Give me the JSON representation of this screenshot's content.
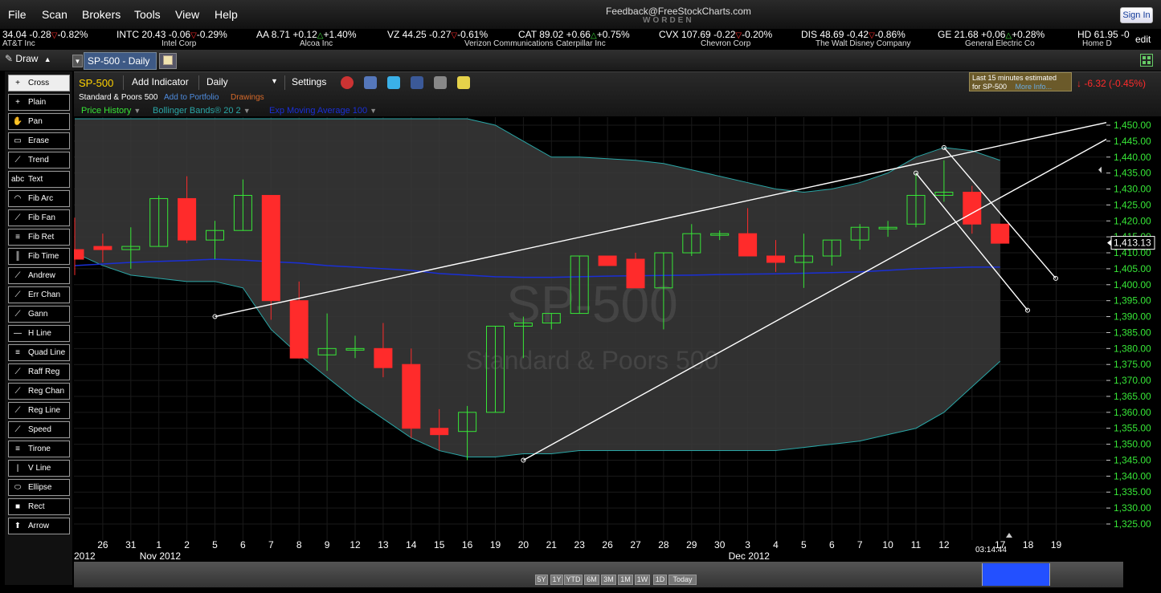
{
  "menu": {
    "items": [
      "File",
      "Scan",
      "Brokers",
      "Tools",
      "View",
      "Help"
    ],
    "feedback": "Feedback@FreeStockCharts.com",
    "brand": "WORDEN",
    "signin": "Sign In"
  },
  "ticker": [
    {
      "price": "34.04",
      "chg": "-0.28",
      "pct": "-0.82%",
      "dir": "down",
      "name": "AT&T Inc"
    },
    {
      "sym": "INTC",
      "price": "20.43",
      "chg": "-0.06",
      "pct": "-0.29%",
      "dir": "down",
      "name": "Intel Corp"
    },
    {
      "sym": "AA",
      "price": "8.71",
      "chg": "+0.12",
      "pct": "+1.40%",
      "dir": "up",
      "name": "Alcoa Inc"
    },
    {
      "sym": "VZ",
      "price": "44.25",
      "chg": "-0.27",
      "pct": "-0.61%",
      "dir": "down",
      "name": "Verizon Communications"
    },
    {
      "sym": "CAT",
      "price": "89.02",
      "chg": "+0.66",
      "pct": "+0.75%",
      "dir": "up",
      "name": "Caterpillar Inc"
    },
    {
      "sym": "CVX",
      "price": "107.69",
      "chg": "-0.22",
      "pct": "-0.20%",
      "dir": "down",
      "name": "Chevron Corp"
    },
    {
      "sym": "DIS",
      "price": "48.69",
      "chg": "-0.42",
      "pct": "-0.86%",
      "dir": "down",
      "name": "The Walt Disney Company"
    },
    {
      "sym": "GE",
      "price": "21.68",
      "chg": "+0.06",
      "pct": "+0.28%",
      "dir": "up",
      "name": "General Electric Co"
    },
    {
      "sym": "HD",
      "price": "61.95",
      "chg": "-0",
      "pct": "",
      "dir": "",
      "name": "Home D"
    }
  ],
  "toolbar": {
    "draw_label": "Draw",
    "tab_label": "SP-500 - Daily",
    "edit_label": "edit"
  },
  "tools": [
    "Cross",
    "Plain",
    "Pan",
    "Erase",
    "Trend",
    "Text",
    "Fib Arc",
    "Fib Fan",
    "Fib Ret",
    "Fib Time",
    "Andrew",
    "Err Chan",
    "Gann",
    "H Line",
    "Quad Line",
    "Raff Reg",
    "Reg Chan",
    "Reg Line",
    "Speed",
    "Tirone",
    "V Line",
    "Ellipse",
    "Rect",
    "Arrow"
  ],
  "tool_icons": [
    "+",
    "+",
    "✋",
    "▭",
    "⟋",
    "abc",
    "◠",
    "⟋",
    "≡",
    "║",
    "⟋",
    "⟋",
    "⟋",
    "—",
    "≡",
    "⟋",
    "⟋",
    "⟋",
    "⟋",
    "≡",
    "|",
    "⬭",
    "■",
    "⬆"
  ],
  "header": {
    "symbol": "SP-500",
    "add_indicator": "Add Indicator",
    "period": "Daily",
    "settings": "Settings",
    "company": "Standard & Poors 500",
    "add_portfolio": "Add to Portfolio",
    "drawings": "Drawings",
    "ind1": "Price History",
    "ind2": "Bollinger Bands® 20 2",
    "ind3": "Exp Moving Average 100",
    "est_line1": "Last 15 minutes estimated",
    "est_line2": "for SP-500",
    "more_info": "More Info...",
    "change": "-6.32 (-0.45%)"
  },
  "colors": {
    "up": "#37e637",
    "down": "#ff2b2b",
    "band_fill": "#3a3a3a",
    "band_line": "#2aa6a6",
    "ema": "#1a2fd6",
    "symbol": "#ffd200"
  },
  "chart_data": {
    "type": "candlestick",
    "watermark_symbol": "SP-500",
    "watermark_name": "Standard & Poors 500",
    "last_price": "1,413.13",
    "y_ticks": [
      "1,450.00",
      "1,445.00",
      "1,440.00",
      "1,435.00",
      "1,430.00",
      "1,425.00",
      "1,420.00",
      "1,415.00",
      "1,410.00",
      "1,405.00",
      "1,400.00",
      "1,395.00",
      "1,390.00",
      "1,385.00",
      "1,380.00",
      "1,375.00",
      "1,370.00",
      "1,365.00",
      "1,360.00",
      "1,355.00",
      "1,350.00",
      "1,345.00",
      "1,340.00",
      "1,335.00",
      "1,330.00",
      "1,325.00"
    ],
    "y_range": [
      1322,
      1452
    ],
    "x_dates": [
      "26",
      "31",
      "1",
      "2",
      "5",
      "6",
      "7",
      "8",
      "9",
      "12",
      "13",
      "14",
      "15",
      "16",
      "19",
      "20",
      "21",
      "23",
      "26",
      "27",
      "28",
      "29",
      "30",
      "3",
      "4",
      "5",
      "6",
      "7",
      "10",
      "11",
      "12",
      "",
      "17",
      "18",
      "19"
    ],
    "month_labels": [
      {
        "label": "2012",
        "index": -0.5
      },
      {
        "label": "Nov 2012",
        "index": 2
      },
      {
        "label": "Dec 2012",
        "index": 23
      },
      {
        "label": "03:14:44",
        "index": 31
      }
    ],
    "candles": [
      {
        "o": 1411,
        "h": 1421,
        "l": 1403,
        "c": 1408
      },
      {
        "o": 1412,
        "h": 1416,
        "l": 1407,
        "c": 1411
      },
      {
        "o": 1411,
        "h": 1418,
        "l": 1405,
        "c": 1412
      },
      {
        "o": 1412,
        "h": 1428,
        "l": 1412,
        "c": 1427
      },
      {
        "o": 1427,
        "h": 1434,
        "l": 1413,
        "c": 1414
      },
      {
        "o": 1414,
        "h": 1420,
        "l": 1408,
        "c": 1417
      },
      {
        "o": 1417,
        "h": 1433,
        "l": 1417,
        "c": 1428
      },
      {
        "o": 1428,
        "h": 1428,
        "l": 1389,
        "c": 1395
      },
      {
        "o": 1395,
        "h": 1401,
        "l": 1377,
        "c": 1377
      },
      {
        "o": 1378,
        "h": 1391,
        "l": 1373,
        "c": 1380
      },
      {
        "o": 1380,
        "h": 1384,
        "l": 1377,
        "c": 1380
      },
      {
        "o": 1380,
        "h": 1388,
        "l": 1371,
        "c": 1374
      },
      {
        "o": 1375,
        "h": 1380,
        "l": 1352,
        "c": 1355
      },
      {
        "o": 1355,
        "h": 1361,
        "l": 1348,
        "c": 1353
      },
      {
        "o": 1354,
        "h": 1362,
        "l": 1345,
        "c": 1360
      },
      {
        "o": 1360,
        "h": 1387,
        "l": 1360,
        "c": 1387
      },
      {
        "o": 1387,
        "h": 1390,
        "l": 1377,
        "c": 1388
      },
      {
        "o": 1388,
        "h": 1391,
        "l": 1386,
        "c": 1391
      },
      {
        "o": 1391,
        "h": 1409,
        "l": 1391,
        "c": 1409
      },
      {
        "o": 1409,
        "h": 1409,
        "l": 1406,
        "c": 1406
      },
      {
        "o": 1408,
        "h": 1410,
        "l": 1399,
        "c": 1399
      },
      {
        "o": 1399,
        "h": 1410,
        "l": 1386,
        "c": 1410
      },
      {
        "o": 1410,
        "h": 1419,
        "l": 1409,
        "c": 1416
      },
      {
        "o": 1416,
        "h": 1417,
        "l": 1414,
        "c": 1416
      },
      {
        "o": 1416,
        "h": 1424,
        "l": 1409,
        "c": 1409
      },
      {
        "o": 1409,
        "h": 1414,
        "l": 1404,
        "c": 1407
      },
      {
        "o": 1407,
        "h": 1416,
        "l": 1399,
        "c": 1409
      },
      {
        "o": 1409,
        "h": 1414,
        "l": 1406,
        "c": 1414
      },
      {
        "o": 1414,
        "h": 1419,
        "l": 1411,
        "c": 1418
      },
      {
        "o": 1418,
        "h": 1420,
        "l": 1415,
        "c": 1418
      },
      {
        "o": 1419,
        "h": 1435,
        "l": 1418,
        "c": 1428
      },
      {
        "o": 1428,
        "h": 1439,
        "l": 1426,
        "c": 1429
      },
      {
        "o": 1429,
        "h": 1431,
        "l": 1416,
        "c": 1419
      },
      {
        "o": 1419,
        "h": 1419,
        "l": 1413,
        "c": 1413
      }
    ],
    "bollinger_upper": [
      1452,
      1452,
      1452,
      1452,
      1452,
      1452,
      1452,
      1452,
      1452,
      1452,
      1452,
      1452,
      1452,
      1452,
      1452,
      1450,
      1445,
      1440,
      1440,
      1439.5,
      1439,
      1438,
      1436,
      1434,
      1432,
      1430,
      1429,
      1430,
      1432,
      1435,
      1440,
      1443,
      1442,
      1439
    ],
    "bollinger_lower": [
      1410,
      1406,
      1403,
      1402,
      1401,
      1401,
      1399,
      1386,
      1378,
      1371,
      1364,
      1358,
      1352,
      1348,
      1346,
      1346,
      1347,
      1347,
      1348,
      1348,
      1348,
      1348,
      1348,
      1348,
      1348,
      1348,
      1349,
      1350,
      1351,
      1353,
      1355,
      1360,
      1368,
      1376
    ],
    "ema100": [
      1406,
      1406.5,
      1407,
      1407.3,
      1407.6,
      1408,
      1407.7,
      1407.2,
      1406.8,
      1406,
      1405.5,
      1405,
      1404.5,
      1403.5,
      1403,
      1402.5,
      1402.3,
      1402.3,
      1402.5,
      1402.7,
      1402.8,
      1402.9,
      1403,
      1403.2,
      1403.3,
      1403.4,
      1403.6,
      1403.8,
      1404,
      1404.5,
      1405,
      1405.3,
      1405.5,
      1405.5
    ],
    "trendlines": [
      {
        "x1": 5,
        "y1": 1390,
        "x2": 35,
        "y2": 1451
      },
      {
        "x1": 16,
        "y1": 1345,
        "x2": 35,
        "y2": 1446
      },
      {
        "x1": 12,
        "y1": 1443,
        "x2": 16,
        "y2": 1402
      },
      {
        "x1": 11,
        "y1": 1435,
        "x2": 15,
        "y2": 1392
      }
    ]
  },
  "bottom": {
    "ranges": [
      "5Y",
      "1Y",
      "YTD",
      "6M",
      "3M",
      "1M",
      "1W",
      "1D",
      "Today"
    ]
  }
}
